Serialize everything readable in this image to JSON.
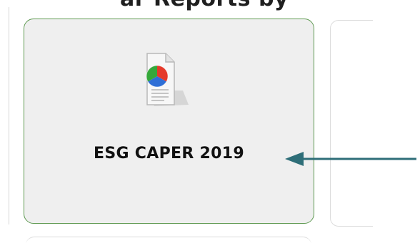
{
  "page": {
    "heading_fragment": "ar Reports by"
  },
  "tile": {
    "label": "ESG CAPER 2019",
    "icon": "report-pie-chart-icon",
    "border_color": "#5f9a52",
    "background_color": "#efefef"
  },
  "annotation": {
    "arrow_icon": "arrow-left-icon",
    "color": "#2e6e78"
  }
}
